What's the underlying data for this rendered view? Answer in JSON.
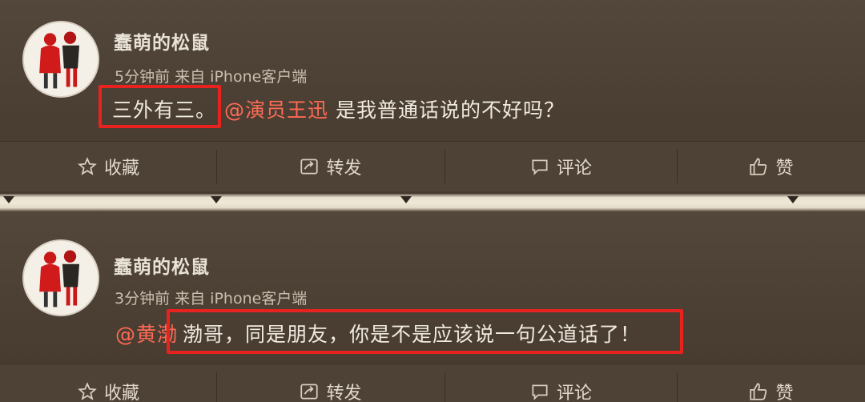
{
  "posts": [
    {
      "username": "蠢萌的松鼠",
      "meta": "5分钟前 来自 iPhone客户端",
      "content_before": "三外有三。",
      "mention": "@演员王迅",
      "content_after": " 是我普通话说的不好吗？",
      "actions": {
        "favorite": "收藏",
        "repost": "转发",
        "comment": "评论",
        "like": "赞"
      }
    },
    {
      "username": "蠢萌的松鼠",
      "meta": "3分钟前 来自 iPhone客户端",
      "mention": "@黄渤",
      "content": "渤哥，同是朋友，你是不是应该说一句公道话了！",
      "actions": {
        "favorite": "收藏",
        "repost": "转发",
        "comment": "评论",
        "like": "赞"
      }
    }
  ],
  "icons": {
    "favorite": "star-icon",
    "repost": "repost-icon",
    "comment": "comment-icon",
    "like": "thumbs-up-icon"
  },
  "colors": {
    "highlight": "#e8221f",
    "mention": "#ff6a55",
    "background": "#4b3f33"
  }
}
